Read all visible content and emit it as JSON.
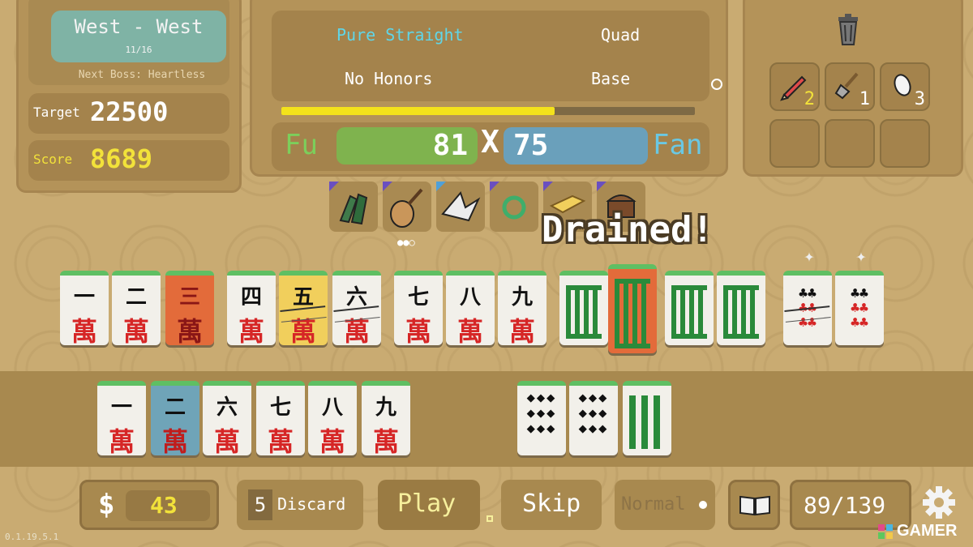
{
  "round": {
    "name": "West - West",
    "count": "11/16",
    "next_boss": "Next Boss: Heartless"
  },
  "target": {
    "label": "Target",
    "value": "22500"
  },
  "score": {
    "label": "Score",
    "value": "8689"
  },
  "hands": [
    "Pure Straight",
    "Quad",
    "No Honors",
    "Base"
  ],
  "progress_fraction": 0.66,
  "fu": {
    "label": "Fu",
    "value": "81"
  },
  "times": "X",
  "fan": {
    "label": "Fan",
    "value": "75"
  },
  "consumables": [
    {
      "icon": "pencil-icon",
      "count": "2",
      "color": "#f2e23a"
    },
    {
      "icon": "shovel-icon",
      "count": "1",
      "color": "#ffffff"
    },
    {
      "icon": "egg-icon",
      "count": "3",
      "color": "#ffffff"
    }
  ],
  "relics": [
    {
      "icon": "bamboo-bundle-icon",
      "corner": "#6a4fc0"
    },
    {
      "icon": "pipa-lute-icon",
      "corner": "#6a4fc0"
    },
    {
      "icon": "paper-crane-icon",
      "corner": "#4fa0d8"
    },
    {
      "icon": "jade-ring-icon",
      "corner": "#6a4fc0"
    },
    {
      "icon": "gold-ingot-icon",
      "corner": "#6a4fc0"
    },
    {
      "icon": "treasure-chest-icon",
      "corner": "#6a4fc0"
    }
  ],
  "status_text": "Drained!",
  "relic_dots": "●●○",
  "meld_tiles": [
    {
      "num": "一",
      "suit": "萬",
      "style": ""
    },
    {
      "num": "二",
      "suit": "萬",
      "style": ""
    },
    {
      "num": "三",
      "suit": "萬",
      "style": "orange"
    },
    {
      "num": "四",
      "suit": "萬",
      "style": ""
    },
    {
      "num": "五",
      "suit": "萬",
      "style": "gold cracked"
    },
    {
      "num": "六",
      "suit": "萬",
      "style": "cracked"
    },
    {
      "num": "七",
      "suit": "萬",
      "style": ""
    },
    {
      "num": "八",
      "suit": "萬",
      "style": ""
    },
    {
      "num": "九",
      "suit": "萬",
      "style": ""
    }
  ],
  "hand_tiles": [
    {
      "num": "一",
      "suit": "萬",
      "style": ""
    },
    {
      "num": "二",
      "suit": "萬",
      "style": "blue"
    },
    {
      "num": "六",
      "suit": "萬",
      "style": ""
    },
    {
      "num": "七",
      "suit": "萬",
      "style": ""
    },
    {
      "num": "八",
      "suit": "萬",
      "style": ""
    },
    {
      "num": "九",
      "suit": "萬",
      "style": ""
    }
  ],
  "buttons": {
    "money_symbol": "$",
    "money": "43",
    "discard_count": "5",
    "discard": "Discard",
    "play": "Play",
    "skip": "Skip",
    "mode": "Normal",
    "wall": "89/139"
  },
  "version": "0.1.19.5.1",
  "watermark": "GAMER"
}
